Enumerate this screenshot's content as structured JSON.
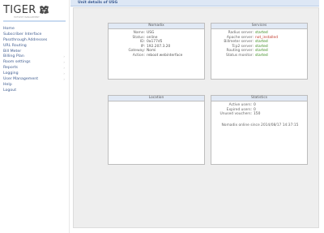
{
  "logo": {
    "text": "TIGER",
    "subtitle": "HOTSPOT MANAGEMENT"
  },
  "nav": [
    {
      "label": "Home",
      "has_submenu": false
    },
    {
      "label": "Subscriber Interface",
      "has_submenu": false
    },
    {
      "label": "Passthrough Addresses",
      "has_submenu": false
    },
    {
      "label": "URL Routing",
      "has_submenu": false
    },
    {
      "label": "Bill Meter",
      "has_submenu": false
    },
    {
      "label": "Billing Plan",
      "has_submenu": true
    },
    {
      "label": "Room settings",
      "has_submenu": true
    },
    {
      "label": "Reports",
      "has_submenu": true
    },
    {
      "label": "Logging",
      "has_submenu": true
    },
    {
      "label": "User Management",
      "has_submenu": true
    },
    {
      "label": "Help",
      "has_submenu": false
    },
    {
      "label": "Logout",
      "has_submenu": false
    }
  ],
  "page_title": "Unit details of USG",
  "nomadix": {
    "title": "Nomadix",
    "rows": [
      {
        "key": "Name:",
        "value": "USG"
      },
      {
        "key": "Status:",
        "value": "online"
      },
      {
        "key": "ID:",
        "value": "0a177d5"
      },
      {
        "key": "IP:",
        "value": "192.207.3.20"
      },
      {
        "key": "Gateway:",
        "value": "Nomi"
      },
      {
        "key": "Action:",
        "value": "reboot  webinterface"
      }
    ]
  },
  "services": {
    "title": "Services",
    "rows": [
      {
        "key": "Radius server:",
        "value": "started",
        "status": "ok"
      },
      {
        "key": "Apache server:",
        "value": "not_installed",
        "status": "bad"
      },
      {
        "key": "Billmeter server:",
        "value": "started",
        "status": "ok"
      },
      {
        "key": "Tcp2 server:",
        "value": "started",
        "status": "ok"
      },
      {
        "key": "Routing server:",
        "value": "started",
        "status": "ok"
      },
      {
        "key": "Status monitor:",
        "value": "started",
        "status": "ok"
      }
    ]
  },
  "location": {
    "title": "Location"
  },
  "statistics": {
    "title": "Statistics",
    "rows": [
      {
        "key": "Active users:",
        "value": "0"
      },
      {
        "key": "Expired users:",
        "value": "0"
      },
      {
        "key": "Unused vouchers:",
        "value": "150"
      }
    ],
    "online_since": "Nomadix online since 2014/08/17 14:37:15"
  },
  "colors": {
    "link": "#3f5c8f",
    "header_bg": "#dde7f5",
    "panel_head_bg": "#e1e9f5",
    "status_ok": "#3a8a1e",
    "status_bad": "#c0392b"
  },
  "icons": {
    "logo_mark": "tiger-head-icon",
    "submenu_arrow": "chevron-right-icon"
  }
}
